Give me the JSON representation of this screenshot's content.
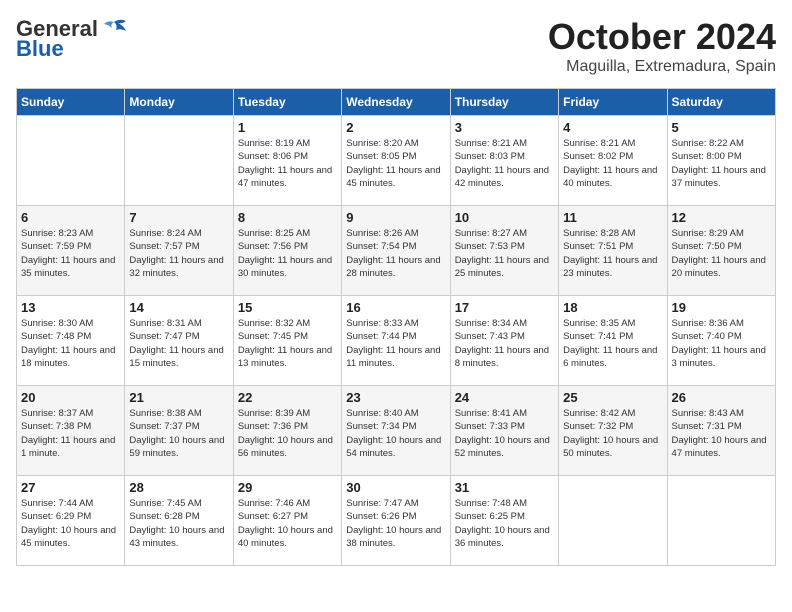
{
  "logo": {
    "general": "General",
    "blue": "Blue"
  },
  "header": {
    "month": "October 2024",
    "location": "Maguilla, Extremadura, Spain"
  },
  "weekdays": [
    "Sunday",
    "Monday",
    "Tuesday",
    "Wednesday",
    "Thursday",
    "Friday",
    "Saturday"
  ],
  "weeks": [
    [
      {
        "day": "",
        "info": ""
      },
      {
        "day": "",
        "info": ""
      },
      {
        "day": "1",
        "info": "Sunrise: 8:19 AM\nSunset: 8:06 PM\nDaylight: 11 hours and 47 minutes."
      },
      {
        "day": "2",
        "info": "Sunrise: 8:20 AM\nSunset: 8:05 PM\nDaylight: 11 hours and 45 minutes."
      },
      {
        "day": "3",
        "info": "Sunrise: 8:21 AM\nSunset: 8:03 PM\nDaylight: 11 hours and 42 minutes."
      },
      {
        "day": "4",
        "info": "Sunrise: 8:21 AM\nSunset: 8:02 PM\nDaylight: 11 hours and 40 minutes."
      },
      {
        "day": "5",
        "info": "Sunrise: 8:22 AM\nSunset: 8:00 PM\nDaylight: 11 hours and 37 minutes."
      }
    ],
    [
      {
        "day": "6",
        "info": "Sunrise: 8:23 AM\nSunset: 7:59 PM\nDaylight: 11 hours and 35 minutes."
      },
      {
        "day": "7",
        "info": "Sunrise: 8:24 AM\nSunset: 7:57 PM\nDaylight: 11 hours and 32 minutes."
      },
      {
        "day": "8",
        "info": "Sunrise: 8:25 AM\nSunset: 7:56 PM\nDaylight: 11 hours and 30 minutes."
      },
      {
        "day": "9",
        "info": "Sunrise: 8:26 AM\nSunset: 7:54 PM\nDaylight: 11 hours and 28 minutes."
      },
      {
        "day": "10",
        "info": "Sunrise: 8:27 AM\nSunset: 7:53 PM\nDaylight: 11 hours and 25 minutes."
      },
      {
        "day": "11",
        "info": "Sunrise: 8:28 AM\nSunset: 7:51 PM\nDaylight: 11 hours and 23 minutes."
      },
      {
        "day": "12",
        "info": "Sunrise: 8:29 AM\nSunset: 7:50 PM\nDaylight: 11 hours and 20 minutes."
      }
    ],
    [
      {
        "day": "13",
        "info": "Sunrise: 8:30 AM\nSunset: 7:48 PM\nDaylight: 11 hours and 18 minutes."
      },
      {
        "day": "14",
        "info": "Sunrise: 8:31 AM\nSunset: 7:47 PM\nDaylight: 11 hours and 15 minutes."
      },
      {
        "day": "15",
        "info": "Sunrise: 8:32 AM\nSunset: 7:45 PM\nDaylight: 11 hours and 13 minutes."
      },
      {
        "day": "16",
        "info": "Sunrise: 8:33 AM\nSunset: 7:44 PM\nDaylight: 11 hours and 11 minutes."
      },
      {
        "day": "17",
        "info": "Sunrise: 8:34 AM\nSunset: 7:43 PM\nDaylight: 11 hours and 8 minutes."
      },
      {
        "day": "18",
        "info": "Sunrise: 8:35 AM\nSunset: 7:41 PM\nDaylight: 11 hours and 6 minutes."
      },
      {
        "day": "19",
        "info": "Sunrise: 8:36 AM\nSunset: 7:40 PM\nDaylight: 11 hours and 3 minutes."
      }
    ],
    [
      {
        "day": "20",
        "info": "Sunrise: 8:37 AM\nSunset: 7:38 PM\nDaylight: 11 hours and 1 minute."
      },
      {
        "day": "21",
        "info": "Sunrise: 8:38 AM\nSunset: 7:37 PM\nDaylight: 10 hours and 59 minutes."
      },
      {
        "day": "22",
        "info": "Sunrise: 8:39 AM\nSunset: 7:36 PM\nDaylight: 10 hours and 56 minutes."
      },
      {
        "day": "23",
        "info": "Sunrise: 8:40 AM\nSunset: 7:34 PM\nDaylight: 10 hours and 54 minutes."
      },
      {
        "day": "24",
        "info": "Sunrise: 8:41 AM\nSunset: 7:33 PM\nDaylight: 10 hours and 52 minutes."
      },
      {
        "day": "25",
        "info": "Sunrise: 8:42 AM\nSunset: 7:32 PM\nDaylight: 10 hours and 50 minutes."
      },
      {
        "day": "26",
        "info": "Sunrise: 8:43 AM\nSunset: 7:31 PM\nDaylight: 10 hours and 47 minutes."
      }
    ],
    [
      {
        "day": "27",
        "info": "Sunrise: 7:44 AM\nSunset: 6:29 PM\nDaylight: 10 hours and 45 minutes."
      },
      {
        "day": "28",
        "info": "Sunrise: 7:45 AM\nSunset: 6:28 PM\nDaylight: 10 hours and 43 minutes."
      },
      {
        "day": "29",
        "info": "Sunrise: 7:46 AM\nSunset: 6:27 PM\nDaylight: 10 hours and 40 minutes."
      },
      {
        "day": "30",
        "info": "Sunrise: 7:47 AM\nSunset: 6:26 PM\nDaylight: 10 hours and 38 minutes."
      },
      {
        "day": "31",
        "info": "Sunrise: 7:48 AM\nSunset: 6:25 PM\nDaylight: 10 hours and 36 minutes."
      },
      {
        "day": "",
        "info": ""
      },
      {
        "day": "",
        "info": ""
      }
    ]
  ]
}
